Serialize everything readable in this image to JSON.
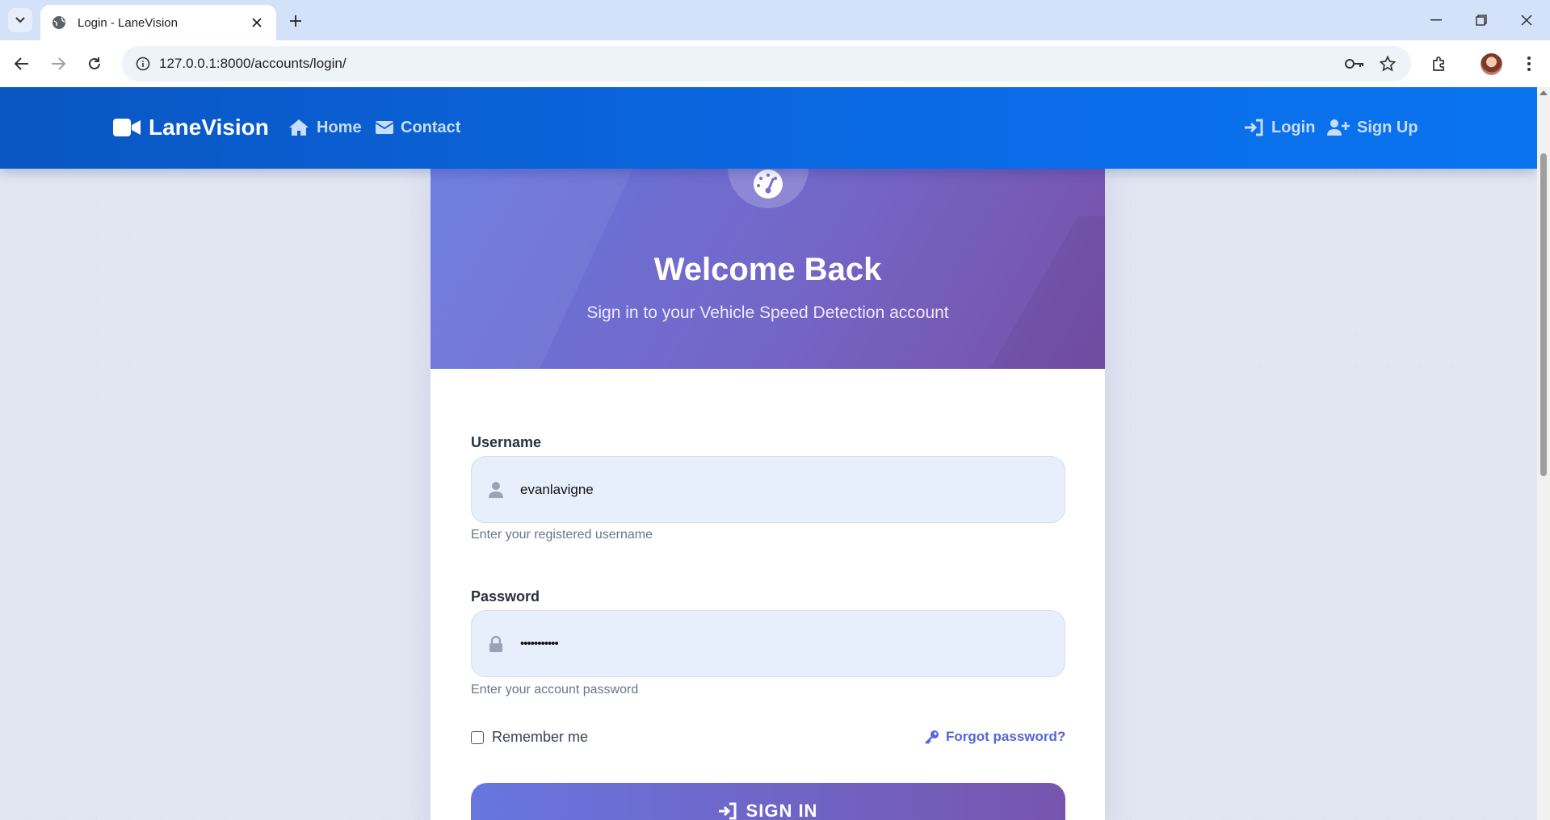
{
  "browser": {
    "tab_title": "Login - LaneVision",
    "url": "127.0.0.1:8000/accounts/login/"
  },
  "navbar": {
    "brand": "LaneVision",
    "links": [
      {
        "label": "Home",
        "icon": "home-icon"
      },
      {
        "label": "Contact",
        "icon": "envelope-icon"
      }
    ],
    "auth": [
      {
        "label": "Login",
        "icon": "sign-in-icon"
      },
      {
        "label": "Sign Up",
        "icon": "user-plus-icon"
      }
    ]
  },
  "card": {
    "icon": "speedometer-icon",
    "title": "Welcome Back",
    "subtitle": "Sign in to your Vehicle Speed Detection account",
    "username": {
      "label": "Username",
      "value": "evanlavigne",
      "hint": "Enter your registered username"
    },
    "password": {
      "label": "Password",
      "value": "•••••••••••",
      "hint": "Enter your account password"
    },
    "remember_label": "Remember me",
    "forgot_label": "Forgot password?",
    "submit_label": "SIGN IN"
  },
  "colors": {
    "navbar": "#0a6ae6",
    "accent": "#6777de",
    "link": "#5566d8"
  }
}
